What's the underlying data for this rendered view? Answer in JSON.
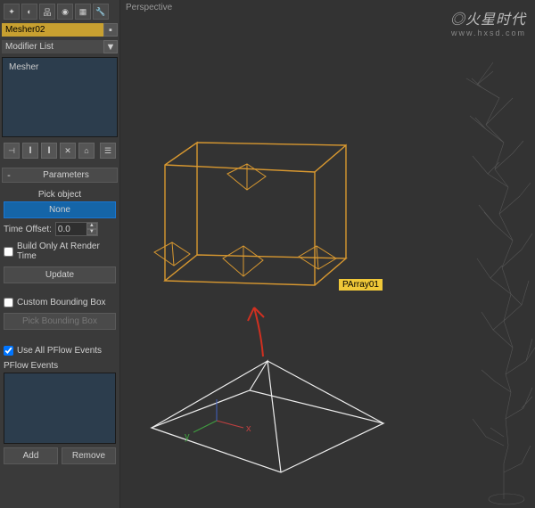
{
  "object_name": "Mesher02",
  "modifier_list_label": "Modifier List",
  "stack": {
    "item": "Mesher"
  },
  "rollout": {
    "title": "Parameters"
  },
  "pick": {
    "label": "Pick object",
    "btn": "None"
  },
  "time_offset": {
    "label": "Time Offset:",
    "value": "0.0"
  },
  "build_render": "Build Only At Render Time",
  "update_btn": "Update",
  "custom_bb": "Custom Bounding Box",
  "pick_bb_btn": "Pick Bounding Box",
  "use_pflow": "Use All PFlow Events",
  "pflow_label": "PFlow Events",
  "add_btn": "Add",
  "remove_btn": "Remove",
  "viewport": {
    "label": "Perspective",
    "object_tag": "PArray01"
  },
  "watermark": {
    "brand": "◎火星时代",
    "url": "www.hxsd.com"
  },
  "axes": {
    "x": "x",
    "y": "y"
  }
}
